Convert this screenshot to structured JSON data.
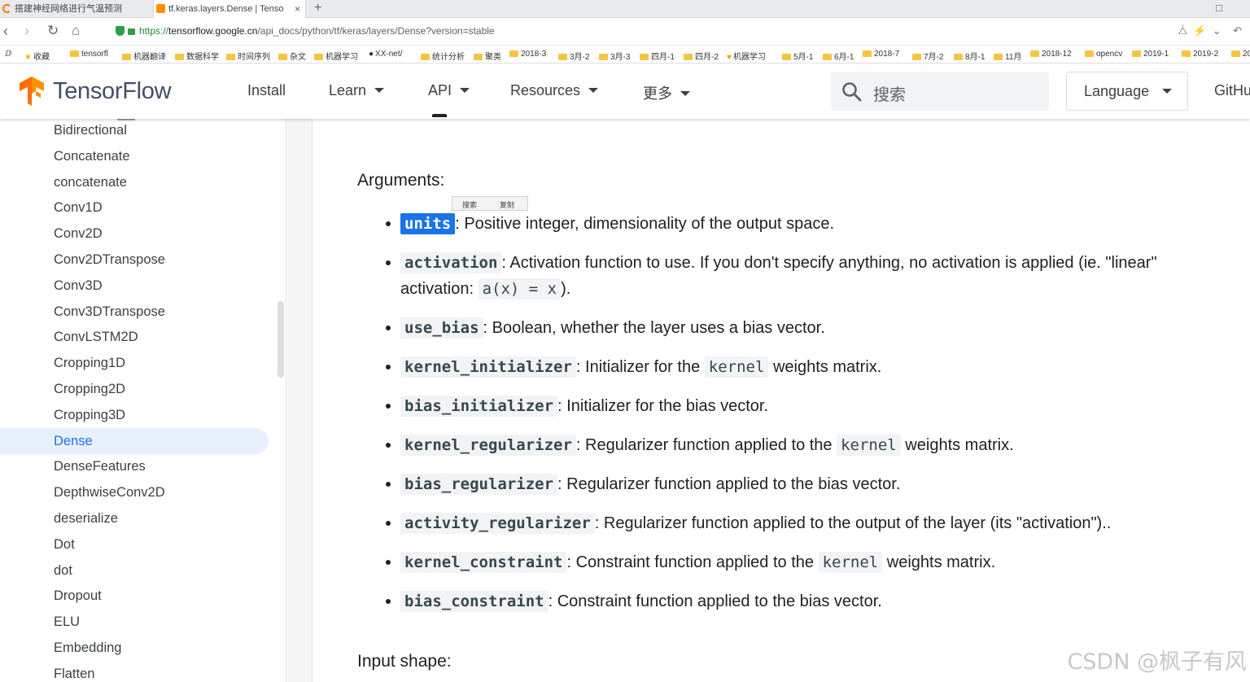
{
  "browser": {
    "tabs": [
      {
        "title": "搭建神经网络进行气温预测"
      },
      {
        "title": "tf.keras.layers.Dense  |  Tenso"
      }
    ],
    "new_tab": "+",
    "close": "×",
    "url_scheme": "https://",
    "url_host": "tensorflow.google.cn",
    "url_path": "/api_docs/python/tf/keras/layers/Dense?version=stable",
    "bookmarks": [
      "收藏",
      "tensorfl",
      "机器翻译",
      "数据科学",
      "时间序列",
      "杂文",
      "机器学习",
      "XX-net/",
      "统计分析",
      "聚类",
      "2018-3",
      "3月-2",
      "3月-3",
      "四月-1",
      "四月-2",
      "机器学习",
      "5月-1",
      "6月-1",
      "2018-7",
      "7月-2",
      "8月-1",
      "11月",
      "2018-12",
      "opencv",
      "2019-1",
      "2019-2",
      "20"
    ]
  },
  "header": {
    "brand": "TensorFlow",
    "nav": [
      {
        "label": "Install",
        "dropdown": false
      },
      {
        "label": "Learn",
        "dropdown": true
      },
      {
        "label": "API",
        "dropdown": true,
        "active": true
      },
      {
        "label": "Resources",
        "dropdown": true
      },
      {
        "label": "更多",
        "dropdown": true
      }
    ],
    "search_placeholder": "搜索",
    "language_label": "Language",
    "github_label": "GitHu"
  },
  "sidebar": {
    "items": [
      "Bidirectional",
      "Concatenate",
      "concatenate",
      "Conv1D",
      "Conv2D",
      "Conv2DTranspose",
      "Conv3D",
      "Conv3DTranspose",
      "ConvLSTM2D",
      "Cropping1D",
      "Cropping2D",
      "Cropping3D",
      "Dense",
      "DenseFeatures",
      "DepthwiseConv2D",
      "deserialize",
      "Dot",
      "dot",
      "Dropout",
      "ELU",
      "Embedding",
      "Flatten"
    ],
    "active_item": "Dense"
  },
  "content": {
    "arguments_heading": "Arguments:",
    "mini_toolbar": {
      "search": "搜索",
      "copy": "复制"
    },
    "arguments": [
      {
        "name": "units",
        "desc": ": Positive integer, dimensionality of the output space."
      },
      {
        "name": "activation",
        "desc": ": Activation function to use. If you don't specify anything, no activation is applied (ie. \"linear\"",
        "desc2_pre": "activation: ",
        "desc2_code": "a(x) = x",
        "desc2_post": ")."
      },
      {
        "name": "use_bias",
        "desc": ": Boolean, whether the layer uses a bias vector."
      },
      {
        "name": "kernel_initializer",
        "desc_pre": ": Initializer for the ",
        "desc_code": "kernel",
        "desc_post": " weights matrix."
      },
      {
        "name": "bias_initializer",
        "desc": ": Initializer for the bias vector."
      },
      {
        "name": "kernel_regularizer",
        "desc_pre": ": Regularizer function applied to the ",
        "desc_code": "kernel",
        "desc_post": " weights matrix."
      },
      {
        "name": "bias_regularizer",
        "desc": ": Regularizer function applied to the bias vector."
      },
      {
        "name": "activity_regularizer",
        "desc": ": Regularizer function applied to the output of the layer (its \"activation\").."
      },
      {
        "name": "kernel_constraint",
        "desc_pre": ": Constraint function applied to the ",
        "desc_code": "kernel",
        "desc_post": " weights matrix."
      },
      {
        "name": "bias_constraint",
        "desc": ": Constraint function applied to the bias vector."
      }
    ],
    "input_shape_heading": "Input shape:"
  },
  "watermark": "CSDN @枫子有风"
}
